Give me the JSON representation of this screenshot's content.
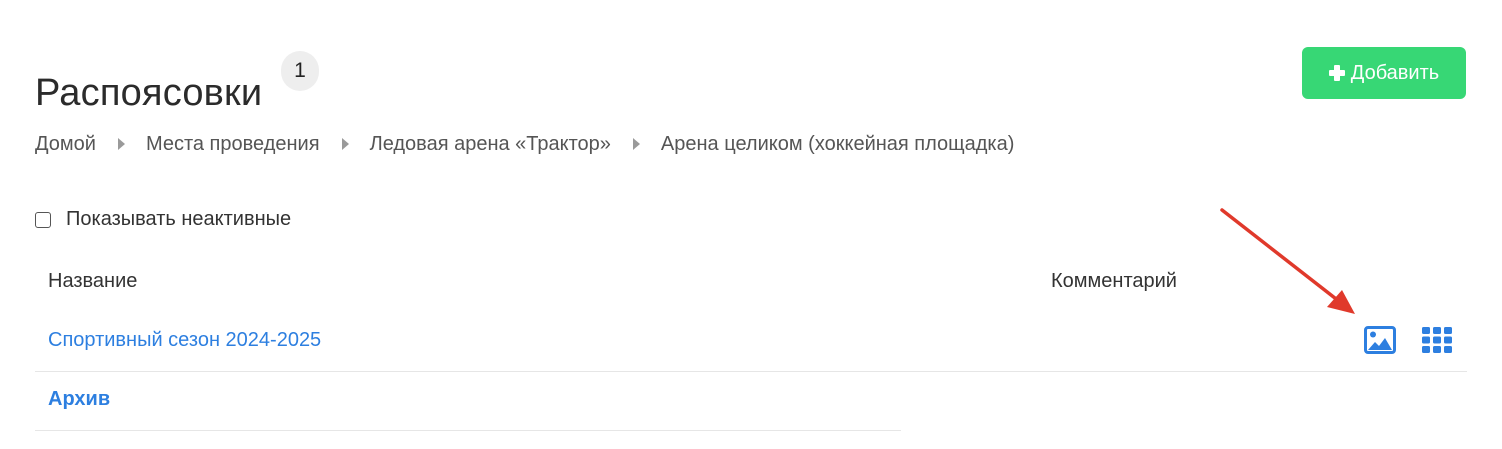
{
  "header": {
    "title": "Распоясовки",
    "count": "1",
    "add_button_label": "Добавить"
  },
  "breadcrumb": {
    "items": [
      "Домой",
      "Места проведения",
      "Ледовая арена «Трактор»",
      "Арена целиком (хоккейная площадка)"
    ]
  },
  "filters": {
    "show_inactive_label": "Показывать неактивные",
    "show_inactive_checked": false
  },
  "table": {
    "columns": [
      "Название",
      "Комментарий"
    ],
    "rows": [
      {
        "name": "Спортивный сезон 2024-2025",
        "comment": ""
      },
      {
        "name": "Архив",
        "comment": ""
      }
    ]
  },
  "icons": {
    "add": "plus-icon",
    "breadcrumb_separator": "caret-right-icon",
    "row_image": "image-icon",
    "row_grid": "grid-icon",
    "annotation": "red-arrow-icon"
  },
  "colors": {
    "accent_green": "#37d775",
    "link_blue": "#2d7fe0",
    "annotation_red": "#e0392b",
    "badge_bg": "#eeeeee"
  }
}
